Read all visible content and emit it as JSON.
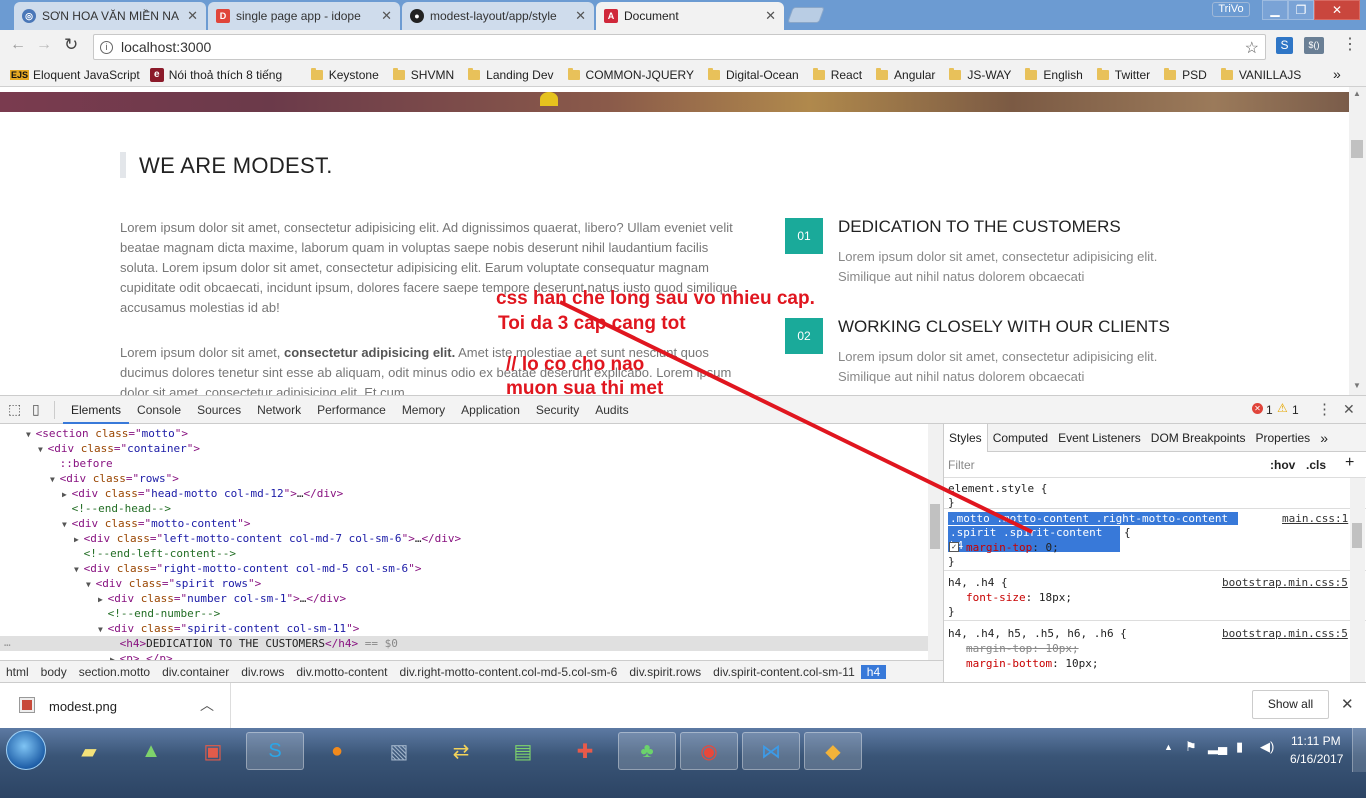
{
  "browser": {
    "tabs": [
      {
        "title": "SƠN HOA VĂN MIỀN NA",
        "favicon": "globe-icon",
        "active": false
      },
      {
        "title": "single page app - idope",
        "favicon": "idope-icon",
        "active": false
      },
      {
        "title": "modest-layout/app/style",
        "favicon": "github-icon",
        "active": false
      },
      {
        "title": "Document",
        "favicon": "angular-icon",
        "active": true
      }
    ],
    "profile_name": "TriVo",
    "url": "localhost:3000",
    "bookmarks": [
      {
        "label": "Eloquent JavaScript",
        "icon": "ejs-icon"
      },
      {
        "label": "Nói thoả thích 8 tiếng",
        "icon": "e-icon"
      },
      {
        "label": "Keystone",
        "icon": "folder-icon"
      },
      {
        "label": "SHVMN",
        "icon": "folder-icon"
      },
      {
        "label": "Landing Dev",
        "icon": "folder-icon"
      },
      {
        "label": "COMMON-JQUERY",
        "icon": "folder-icon"
      },
      {
        "label": "Digital-Ocean",
        "icon": "folder-icon"
      },
      {
        "label": "React",
        "icon": "folder-icon"
      },
      {
        "label": "Angular",
        "icon": "folder-icon"
      },
      {
        "label": "JS-WAY",
        "icon": "folder-icon"
      },
      {
        "label": "English",
        "icon": "folder-icon"
      },
      {
        "label": "Twitter",
        "icon": "folder-icon"
      },
      {
        "label": "PSD",
        "icon": "folder-icon"
      },
      {
        "label": "VANILLAJS",
        "icon": "folder-icon"
      }
    ],
    "bookmarks_more": "»"
  },
  "page": {
    "heading": "WE ARE MODEST.",
    "paragraph1": "Lorem ipsum dolor sit amet, consectetur adipisicing elit. Ad dignissimos quaerat, libero? Ullam eveniet velit beatae magnam dicta maxime, laborum quam in voluptas saepe nobis deserunt nihil laudantium facilis soluta. Lorem ipsum dolor sit amet, consectetur adipisicing elit. Earum voluptate consequatur magnam cupiditate odit obcaecati, incidunt ipsum, dolores facere saepe tempore deserunt natus iusto quod similique accusamus molestias id ab!",
    "paragraph2_prefix": "Lorem ipsum dolor sit amet, ",
    "paragraph2_bold": "consectetur adipisicing elit.",
    "paragraph2_rest": " Amet iste molestiae a et sunt nesciunt quos ducimus dolores tenetur sint esse ab aliquam, odit minus odio ex beatae deserunt explicabo. Lorem ipsum dolor sit amet, consectetur adipisicing elit. Et cum",
    "features": [
      {
        "number": "01",
        "title": "DEDICATION TO THE CUSTOMERS",
        "text": "Lorem ipsum dolor sit amet, consectetur adipisicing elit. Similique aut nihil natus dolorem obcaecati"
      },
      {
        "number": "02",
        "title": "WORKING CLOSELY WITH OUR CLIENTS",
        "text": "Lorem ipsum dolor sit amet, consectetur adipisicing elit. Similique aut nihil natus dolorem obcaecati"
      }
    ],
    "accent": "#1aaa9a"
  },
  "annotation": {
    "line1": "css han che long sau vo nhieu cap.",
    "line2": "Toi da 3 cap cang tot",
    "line3": "// lo co cho nao",
    "line4": "muon sua thi met",
    "color": "#e0161f"
  },
  "devtools": {
    "tabs": [
      "Elements",
      "Console",
      "Sources",
      "Network",
      "Performance",
      "Memory",
      "Application",
      "Security",
      "Audits"
    ],
    "active_tab": "Elements",
    "error_count": "1",
    "warning_count": "1",
    "dom_lines": [
      {
        "indent": 2,
        "arrow": "▼",
        "tag": "section",
        "attrs": [
          [
            "class",
            "motto"
          ]
        ],
        "close": false,
        "kind": "open"
      },
      {
        "indent": 3,
        "arrow": "▼",
        "tag": "div",
        "attrs": [
          [
            "class",
            "container"
          ]
        ],
        "kind": "open"
      },
      {
        "indent": 4,
        "arrow": "",
        "text": "::before",
        "kind": "pseudo"
      },
      {
        "indent": 4,
        "arrow": "▼",
        "tag": "div",
        "attrs": [
          [
            "class",
            "rows"
          ]
        ],
        "kind": "open"
      },
      {
        "indent": 5,
        "arrow": "▶",
        "tag": "div",
        "attrs": [
          [
            "class",
            "head-motto col-md-12"
          ]
        ],
        "kind": "collapsed"
      },
      {
        "indent": 5,
        "arrow": "",
        "text": "<!--end-head-->",
        "kind": "comment"
      },
      {
        "indent": 5,
        "arrow": "▼",
        "tag": "div",
        "attrs": [
          [
            "class",
            "motto-content"
          ]
        ],
        "kind": "open"
      },
      {
        "indent": 6,
        "arrow": "▶",
        "tag": "div",
        "attrs": [
          [
            "class",
            "left-motto-content col-md-7 col-sm-6"
          ]
        ],
        "kind": "collapsed"
      },
      {
        "indent": 6,
        "arrow": "",
        "text": "<!--end-left-content-->",
        "kind": "comment"
      },
      {
        "indent": 6,
        "arrow": "▼",
        "tag": "div",
        "attrs": [
          [
            "class",
            "right-motto-content col-md-5 col-sm-6"
          ]
        ],
        "kind": "open"
      },
      {
        "indent": 7,
        "arrow": "▼",
        "tag": "div",
        "attrs": [
          [
            "class",
            "spirit rows"
          ]
        ],
        "kind": "open"
      },
      {
        "indent": 8,
        "arrow": "▶",
        "tag": "div",
        "attrs": [
          [
            "class",
            "number col-sm-1"
          ]
        ],
        "kind": "collapsed"
      },
      {
        "indent": 8,
        "arrow": "",
        "text": "<!--end-number-->",
        "kind": "comment"
      },
      {
        "indent": 8,
        "arrow": "▼",
        "tag": "div",
        "attrs": [
          [
            "class",
            "spirit-content col-sm-11"
          ]
        ],
        "kind": "open"
      },
      {
        "indent": 9,
        "arrow": "",
        "tag": "h4",
        "text": "DEDICATION TO THE CUSTOMERS",
        "kind": "selected",
        "suffix": " == $0"
      },
      {
        "indent": 9,
        "arrow": "▶",
        "tag": "p",
        "kind": "collapsed_p"
      }
    ],
    "breadcrumbs": [
      "html",
      "body",
      "section.motto",
      "div.container",
      "div.rows",
      "div.motto-content",
      "div.right-motto-content.col-md-5.col-sm-6",
      "div.spirit.rows",
      "div.spirit-content.col-sm-11",
      "h4"
    ],
    "styles_tabs": [
      "Styles",
      "Computed",
      "Event Listeners",
      "DOM Breakpoints",
      "Properties"
    ],
    "styles_more": "»",
    "filter_placeholder": "Filter",
    "hov": ":hov",
    "cls": ".cls",
    "plus": "+",
    "rules": [
      {
        "selector": "element.style {",
        "source": "",
        "props": [],
        "close": "}"
      },
      {
        "selector1": ".motto .motto-content .right-motto-content",
        "selector2": ".spirit .spirit-content h4",
        "source": "main.css:1",
        "props": [
          {
            "name": "margin-top",
            "value": "0;",
            "struck": false,
            "checked": true
          }
        ],
        "highlight": true,
        "close": "}"
      },
      {
        "selector": "h4, .h4 {",
        "source": "bootstrap.min.css:5",
        "props": [
          {
            "name": "font-size",
            "value": "18px;",
            "struck": false
          }
        ],
        "close": "}"
      },
      {
        "selector": "h4, .h4, h5, .h5, h6, .h6 {",
        "source": "bootstrap.min.css:5",
        "props": [
          {
            "name": "margin-top",
            "value": "10px;",
            "struck": true
          },
          {
            "name": "margin-bottom",
            "value": "10px;",
            "struck": false
          }
        ],
        "close": ""
      }
    ]
  },
  "download": {
    "file_name": "modest.png",
    "show_all": "Show all"
  },
  "taskbar": {
    "time": "11:11 PM",
    "date": "6/16/2017",
    "apps": [
      "windows-start-icon",
      "sticky-notes-icon",
      "rocket-icon",
      "remote-desktop-icon",
      "skype-icon",
      "firefox-icon",
      "security-icon",
      "network-icon",
      "chart-icon",
      "tools-icon",
      "solitaire-icon",
      "chrome-icon",
      "vscode-icon",
      "app-icon"
    ]
  }
}
